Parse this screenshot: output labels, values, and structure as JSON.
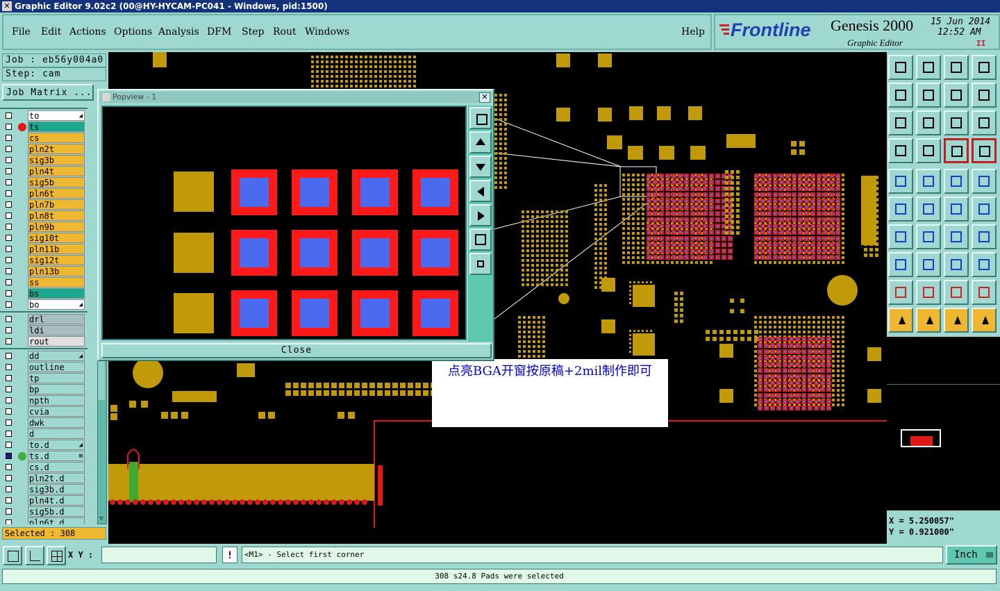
{
  "window": {
    "title": "Graphic Editor 9.02c2 (00@HY-HYCAM-PC041 - Windows, pid:1500)",
    "close_glyph": "✕"
  },
  "menu": {
    "items": [
      "File",
      "Edit",
      "Actions",
      "Options",
      "Analysis",
      "DFM",
      "Step",
      "Rout",
      "Windows"
    ],
    "help": "Help"
  },
  "brand": {
    "logo": "Frontline",
    "product": "Genesis 2000",
    "subtitle": "Graphic Editor",
    "date": "15 Jun 2014",
    "time": "12:52 AM",
    "pause": "II"
  },
  "job": {
    "job_label": "Job : eb56y004a0",
    "step_label": "Step: cam",
    "matrix_button": "Job Matrix ..."
  },
  "layers_group1": [
    {
      "name": "to",
      "color": "#ffffff",
      "mark": "◢"
    },
    {
      "name": "ts",
      "color": "#1aa890",
      "dot": true
    },
    {
      "name": "cs",
      "color": "#f0b830"
    },
    {
      "name": "pln2t",
      "color": "#f0b830"
    },
    {
      "name": "sig3b",
      "color": "#f0b830"
    },
    {
      "name": "pln4t",
      "color": "#f0b830"
    },
    {
      "name": "sig5b",
      "color": "#f0b830"
    },
    {
      "name": "pln6t",
      "color": "#f0b830"
    },
    {
      "name": "pln7b",
      "color": "#f0b830"
    },
    {
      "name": "pln8t",
      "color": "#f0b830"
    },
    {
      "name": "pln9b",
      "color": "#f0b830"
    },
    {
      "name": "sig10t",
      "color": "#f0b830"
    },
    {
      "name": "pln11b",
      "color": "#f0b830"
    },
    {
      "name": "sig12t",
      "color": "#f0b830"
    },
    {
      "name": "pln13b",
      "color": "#f0b830"
    },
    {
      "name": "ss",
      "color": "#f0b830"
    },
    {
      "name": "bs",
      "color": "#1aa890"
    },
    {
      "name": "bo",
      "color": "#ffffff",
      "mark": "◢"
    }
  ],
  "layers_group2": [
    {
      "name": "drl",
      "color": "#a8bcc4"
    },
    {
      "name": "ldi",
      "color": "#a8bcc4"
    },
    {
      "name": "rout",
      "color": "#e0e0e0"
    }
  ],
  "layers_group3": [
    {
      "name": "dd",
      "color": "#9fd8d0",
      "mark": "◢"
    },
    {
      "name": "outline",
      "color": "#9fd8d0"
    },
    {
      "name": "tp",
      "color": "#9fd8d0"
    },
    {
      "name": "bp",
      "color": "#9fd8d0"
    },
    {
      "name": "npth",
      "color": "#9fd8d0"
    },
    {
      "name": "cvia",
      "color": "#9fd8d0"
    },
    {
      "name": "dwk",
      "color": "#9fd8d0"
    },
    {
      "name": "d",
      "color": "#9fd8d0"
    },
    {
      "name": "to.d",
      "color": "#9fd8d0",
      "mark": "◢"
    },
    {
      "name": "ts.d",
      "color": "#9fd8d0",
      "work": true,
      "mark": "⊞"
    },
    {
      "name": "cs.d",
      "color": "#9fd8d0"
    },
    {
      "name": "pln2t.d",
      "color": "#9fd8d0"
    },
    {
      "name": "sig3b.d",
      "color": "#9fd8d0"
    },
    {
      "name": "pln4t.d",
      "color": "#9fd8d0"
    },
    {
      "name": "sig5b.d",
      "color": "#9fd8d0"
    },
    {
      "name": "pln6t.d",
      "color": "#9fd8d0"
    }
  ],
  "selected_label": "Selected : 308",
  "popview": {
    "title": "Popview - 1",
    "close_button": "Close",
    "close_glyph": "✕"
  },
  "annotation": "点亮BGA开窗按原稿+2mil制作即可",
  "coords": {
    "x": "X =  5.250057\"",
    "y": "Y =  0.921000\""
  },
  "bottom": {
    "xy_label": "X Y :",
    "xy_value": "",
    "warn": "!",
    "prompt": "<M1> - Select first corner",
    "units": "Inch",
    "message": "308 s24.8 Pads were selected"
  },
  "colors": {
    "pad": "#c09a08",
    "selected_outer": "#ff1a1a",
    "selected_inner": "#4a6af0",
    "bg": "#9fd8d0"
  }
}
